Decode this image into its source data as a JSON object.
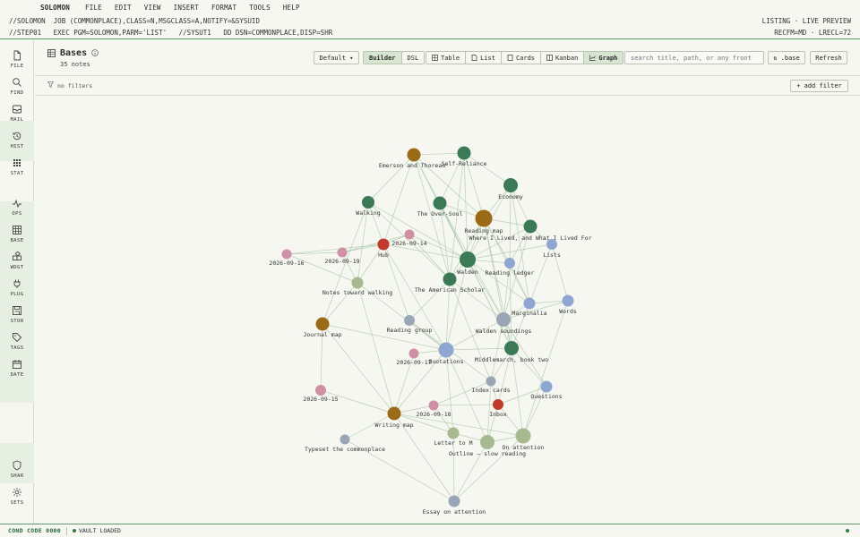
{
  "menu": {
    "app": "SOLOMON",
    "items": [
      "FILE",
      "EDIT",
      "VIEW",
      "INSERT",
      "FORMAT",
      "TOOLS",
      "HELP"
    ]
  },
  "jcl": {
    "line1": "//SOLOMON  JOB (COMMONPLACE),CLASS=N,MSGCLASS=A,NOTIFY=&SYSUID",
    "line2": "//STEP01   EXEC PGM=SOLOMON,PARM='LIST'   //SYSUT1   DD DSN=COMMONPLACE,DISP=SHR",
    "right1": "LISTING · LIVE PREVIEW",
    "right2": "RECFM=MD · LRECL=72"
  },
  "rail": {
    "items": [
      {
        "label": "FILE",
        "icon": "file-icon"
      },
      {
        "label": "FIND",
        "icon": "search-icon"
      },
      {
        "label": "MAIL",
        "icon": "mail-icon"
      },
      {
        "label": "HIST",
        "icon": "history-icon"
      },
      {
        "label": "STAT",
        "icon": "stats-icon"
      },
      {
        "label": "OPS",
        "icon": "pulse-icon"
      },
      {
        "label": "BASE",
        "icon": "grid-icon"
      },
      {
        "label": "WDGT",
        "icon": "widget-icon"
      },
      {
        "label": "PLUG",
        "icon": "plug-icon"
      },
      {
        "label": "STOR",
        "icon": "storage-icon"
      },
      {
        "label": "TAGS",
        "icon": "tag-icon"
      },
      {
        "label": "DATE",
        "icon": "calendar-icon"
      }
    ],
    "bottom": [
      {
        "label": "SHAR",
        "icon": "shield-icon"
      },
      {
        "label": "SETS",
        "icon": "gear-icon"
      }
    ]
  },
  "header": {
    "title": "Bases",
    "subtitle": "35 notes",
    "view_select": "Default ▾",
    "mode_tabs": [
      "Builder",
      "DSL"
    ],
    "view_tabs": [
      "Table",
      "List",
      "Cards",
      "Kanban",
      "Graph"
    ],
    "search_placeholder": "search title, path, or any front",
    "base_button": "⇅ .base",
    "refresh_button": "Refresh"
  },
  "filters": {
    "status": "no filters",
    "add_button": "+ add filter"
  },
  "colors": {
    "dark_green": "#3a7a55",
    "brown": "#9a6a14",
    "sage": "#a7b98f",
    "blue": "#8fa6d2",
    "gray_blue": "#98a6b5",
    "pink": "#cf8fa4",
    "red": "#c0392b",
    "edge": "#a9c7a8"
  },
  "graph": {
    "nodes": [
      {
        "id": 0,
        "label": "Emerson and Thoreau",
        "color": "brown"
      },
      {
        "id": 1,
        "label": "Self-Reliance",
        "color": "dark_green"
      },
      {
        "id": 2,
        "label": "Economy",
        "color": "dark_green"
      },
      {
        "id": 3,
        "label": "Walking",
        "color": "dark_green"
      },
      {
        "id": 4,
        "label": "The Over-Soul",
        "color": "dark_green"
      },
      {
        "id": 5,
        "label": "Reading map",
        "color": "brown"
      },
      {
        "id": 6,
        "label": "Where I Lived, and What I Lived For",
        "color": "dark_green"
      },
      {
        "id": 7,
        "label": "2026-09-14",
        "color": "pink"
      },
      {
        "id": 8,
        "label": "Lists",
        "color": "blue"
      },
      {
        "id": 9,
        "label": "2026-09-16",
        "color": "pink"
      },
      {
        "id": 10,
        "label": "2026-09-19",
        "color": "pink"
      },
      {
        "id": 11,
        "label": "Hub",
        "color": "red"
      },
      {
        "id": 12,
        "label": "Walden",
        "color": "dark_green"
      },
      {
        "id": 13,
        "label": "Reading ledger",
        "color": "blue"
      },
      {
        "id": 14,
        "label": "The American Scholar",
        "color": "dark_green"
      },
      {
        "id": 15,
        "label": "Notes toward walking",
        "color": "sage"
      },
      {
        "id": 16,
        "label": "Marginalia",
        "color": "blue"
      },
      {
        "id": 17,
        "label": "Words",
        "color": "blue"
      },
      {
        "id": 18,
        "label": "Journal map",
        "color": "brown"
      },
      {
        "id": 19,
        "label": "Reading group",
        "color": "gray_blue"
      },
      {
        "id": 20,
        "label": "Walden soundings",
        "color": "gray_blue"
      },
      {
        "id": 21,
        "label": "Quotations",
        "color": "blue"
      },
      {
        "id": 22,
        "label": "Middlemarch, book two",
        "color": "dark_green"
      },
      {
        "id": 23,
        "label": "2026-09-17",
        "color": "pink"
      },
      {
        "id": 24,
        "label": "Index cards",
        "color": "gray_blue"
      },
      {
        "id": 25,
        "label": "Questions",
        "color": "blue"
      },
      {
        "id": 26,
        "label": "2026-09-15",
        "color": "pink"
      },
      {
        "id": 27,
        "label": "Inbox",
        "color": "red"
      },
      {
        "id": 28,
        "label": "2026-09-18",
        "color": "pink"
      },
      {
        "id": 29,
        "label": "Writing map",
        "color": "brown"
      },
      {
        "id": 30,
        "label": "Letter to M",
        "color": "sage"
      },
      {
        "id": 31,
        "label": "On attention",
        "color": "sage"
      },
      {
        "id": 32,
        "label": "Outline — slow reading",
        "color": "sage"
      },
      {
        "id": 33,
        "label": "Typeset the commonplace",
        "color": "gray_blue"
      },
      {
        "id": 34,
        "label": "Essay on attention",
        "color": "gray_blue"
      }
    ]
  },
  "status": {
    "code": "COND CODE 0000",
    "vault": "VAULT LOADED"
  }
}
